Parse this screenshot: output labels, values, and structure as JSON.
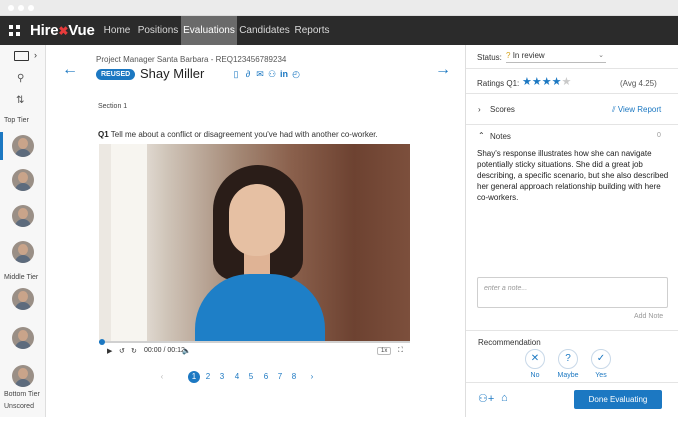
{
  "app": {
    "logo_text": "Hire",
    "logo_text_2": "Vue",
    "nav": [
      "Home",
      "Positions",
      "Evaluations",
      "Candidates",
      "Reports"
    ],
    "active_nav": "Evaluations"
  },
  "sidebar": {
    "tiers": {
      "top": "Top Tier",
      "middle": "Middle Tier",
      "bottom": "Bottom Tier",
      "unscored": "Unscored"
    }
  },
  "candidate": {
    "requisition": "Project Manager Santa Barbara - REQ123456789234",
    "badge": "REUSED",
    "name": "Shay Miller"
  },
  "question": {
    "section": "Section 1",
    "number": "Q1",
    "text": "Tell me about a conflict or disagreement you've had with another co-worker."
  },
  "video": {
    "time": "00:00 / 00:12",
    "speed": "1x",
    "progress": 0.01
  },
  "pagination": {
    "pages": [
      "1",
      "2",
      "3",
      "4",
      "5",
      "6",
      "7",
      "8"
    ],
    "current": "1",
    "prev": "‹",
    "next": "›"
  },
  "evaluation": {
    "status_label": "Status:",
    "status_value": "In review",
    "ratings_label": "Ratings",
    "ratings_q": "Q1:",
    "rating": 4,
    "rating_max": 5,
    "avg": "(Avg 4.25)",
    "scores_label": "Scores",
    "view_report": "View Report",
    "notes_label": "Notes",
    "notes_count": "0",
    "notes_text": "Shay's response illustrates how she can navigate potentially sticky situations. She did a great job describing, a specific scenario, but she also described her general approach relationship building with here co-workers.",
    "note_placeholder": "enter a note...",
    "add_note": "Add Note",
    "recommendation_label": "Recommendation",
    "recommendations": [
      "No",
      "Maybe",
      "Yes"
    ],
    "done_button": "Done Evaluating"
  },
  "colors": {
    "accent": "#1c78c2",
    "navbar": "#2b2b2b",
    "active_nav": "#6a6a6a"
  }
}
